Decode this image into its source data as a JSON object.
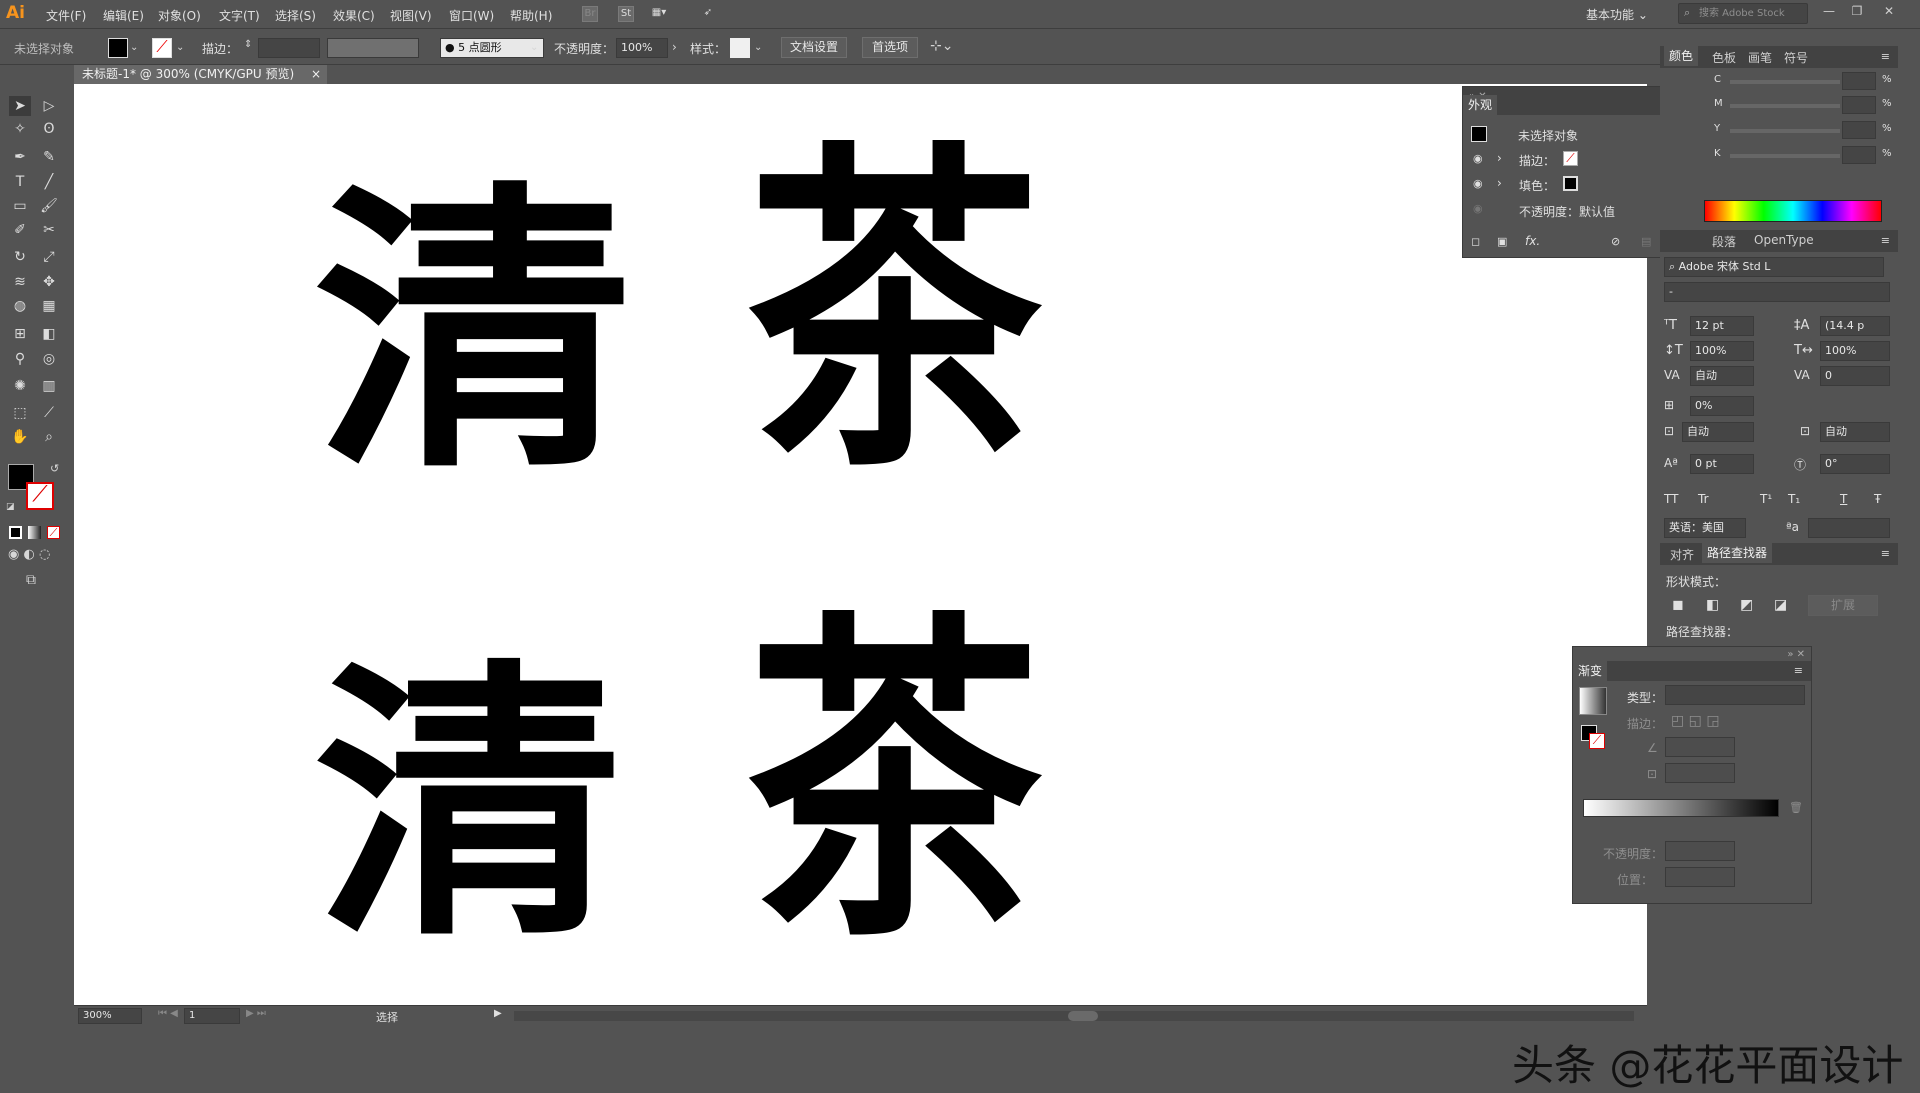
{
  "app": {
    "logo": "Ai"
  },
  "menus": [
    "文件(F)",
    "编辑(E)",
    "对象(O)",
    "文字(T)",
    "选择(S)",
    "效果(C)",
    "视图(V)",
    "窗口(W)",
    "帮助(H)"
  ],
  "toolbar_icons": {
    "br": "Br",
    "st": "St"
  },
  "workspace": "基本功能",
  "search_placeholder": "搜索 Adobe Stock",
  "control": {
    "selection_status": "未选择对象",
    "stroke_label": "描边：",
    "brush_size": "5",
    "brush_shape": "点圆形",
    "opacity_label": "不透明度：",
    "opacity_value": "100%",
    "style_label": "样式：",
    "doc_setup": "文档设置",
    "preferences": "首选项"
  },
  "document_tab": {
    "title": "未标题-1* @ 300% (CMYK/GPU 预览)",
    "close": "×"
  },
  "canvas": {
    "row1": [
      "清",
      "茶"
    ],
    "row2": [
      "清",
      "茶"
    ],
    "watermark": "头条 @花花平面设计"
  },
  "appearance_panel": {
    "title": "外观",
    "header": "未选择对象",
    "stroke_label": "描边：",
    "fill_label": "填色：",
    "opacity_line": "不透明度：默认值",
    "fx": "fx."
  },
  "color_panel": {
    "tabs": [
      "颜色",
      "色板",
      "画笔",
      "符号"
    ],
    "channels": [
      "C",
      "M",
      "Y",
      "K"
    ],
    "unit": "%"
  },
  "char_panel": {
    "tabs": [
      "段落",
      "OpenType"
    ],
    "font": "Adobe 宋体 Std L",
    "style": "-",
    "size": "12 pt",
    "leading": "(14.4 p",
    "vscale": "100%",
    "hscale": "100%",
    "kerning": "自动",
    "tracking": "0",
    "tsume": "0%",
    "aki_left": "自动",
    "aki_right": "自动",
    "baseline": "0 pt",
    "rotation": "0°",
    "lang": "英语：美国",
    "tt_buttons": [
      "TT",
      "Tr",
      "T¹",
      "T₁",
      "T",
      "Ŧ"
    ],
    "aa": "ªa"
  },
  "pathfinder_panel": {
    "tabs": [
      "对齐",
      "路径查找器"
    ],
    "shape_modes": "形状模式：",
    "expand": "扩展",
    "pathfinders": "路径查找器："
  },
  "gradient_panel": {
    "title": "渐变",
    "type_label": "类型：",
    "stroke_label": "描边：",
    "opacity_label": "不透明度：",
    "position_label": "位置："
  },
  "status": {
    "zoom": "300%",
    "page": "1",
    "tool": "选择"
  },
  "colors": {
    "accent": "#f7941d",
    "ui_bg": "#535353",
    "canvas": "#ffffff"
  }
}
